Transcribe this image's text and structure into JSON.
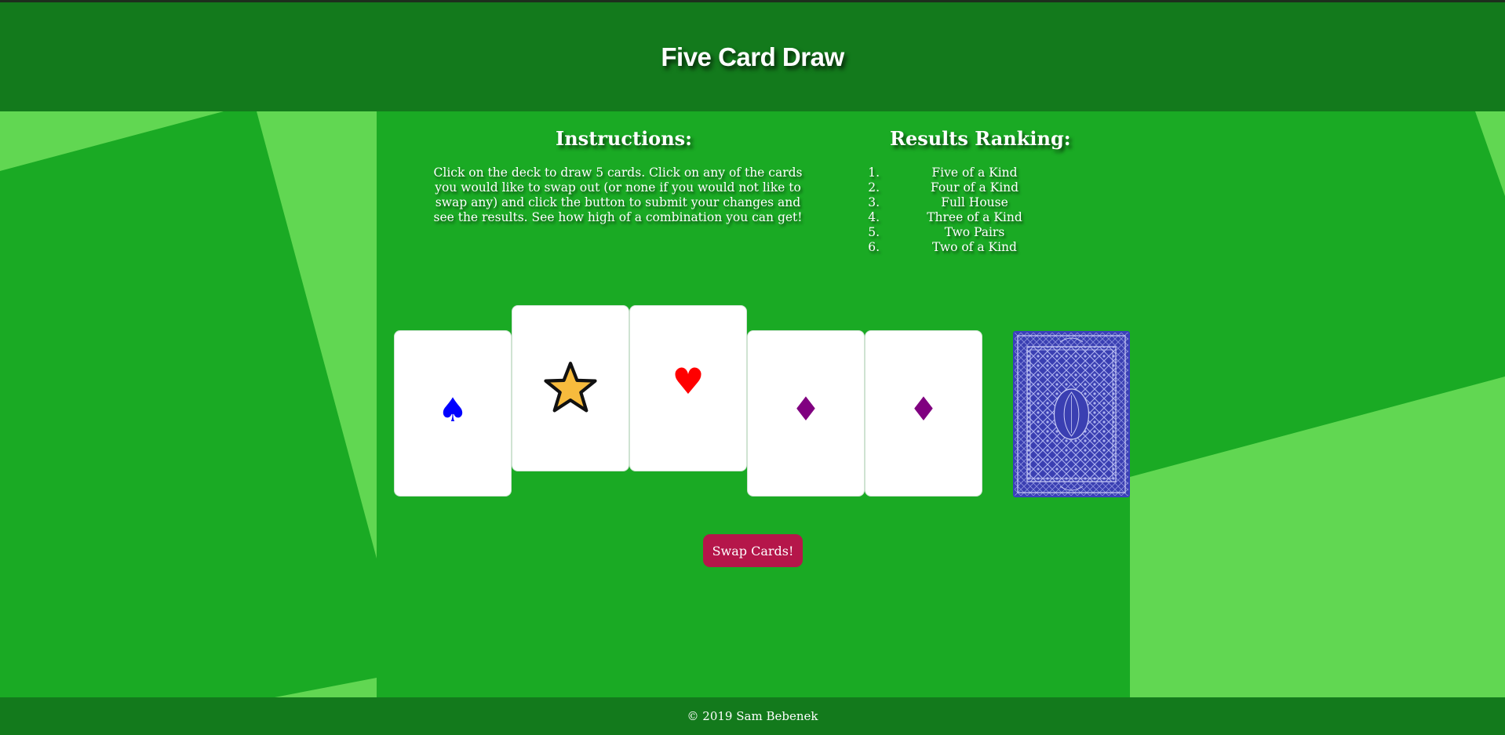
{
  "header": {
    "title": "Five Card Draw"
  },
  "instructions": {
    "title": "Instructions:",
    "text": "Click on the deck to draw 5 cards. Click on any of the cards you would like to swap out (or none if you would not like to swap any) and click the button to submit your changes and see the results. See how high of a combination you can get!"
  },
  "ranking": {
    "title": "Results Ranking:",
    "items": [
      {
        "num": "1.",
        "label": "Five of a Kind"
      },
      {
        "num": "2.",
        "label": "Four of a Kind"
      },
      {
        "num": "3.",
        "label": "Full House"
      },
      {
        "num": "4.",
        "label": "Three of a Kind"
      },
      {
        "num": "5.",
        "label": "Two Pairs"
      },
      {
        "num": "6.",
        "label": "Two of a Kind"
      }
    ]
  },
  "hand": [
    {
      "suit": "spade",
      "glyph": "♠",
      "color": "#0000ff",
      "raised": false
    },
    {
      "suit": "star",
      "glyph": "",
      "color": "#f7bb3d",
      "raised": true
    },
    {
      "suit": "heart",
      "glyph": "♥",
      "color": "#ff0000",
      "raised": true
    },
    {
      "suit": "diamond",
      "glyph": "♦",
      "color": "#800080",
      "raised": false
    },
    {
      "suit": "diamond",
      "glyph": "♦",
      "color": "#800080",
      "raised": false
    }
  ],
  "deck": {
    "icon": "card-back-pattern",
    "color": "#3a3fb2"
  },
  "actions": {
    "swap_label": "Swap Cards!"
  },
  "footer": {
    "text": "© 2019 Sam Bebenek"
  },
  "colors": {
    "header_bg": "#137a1c",
    "table_bg": "#1aaa24",
    "light_panel": "#61d752",
    "button_bg": "#b5164a"
  }
}
